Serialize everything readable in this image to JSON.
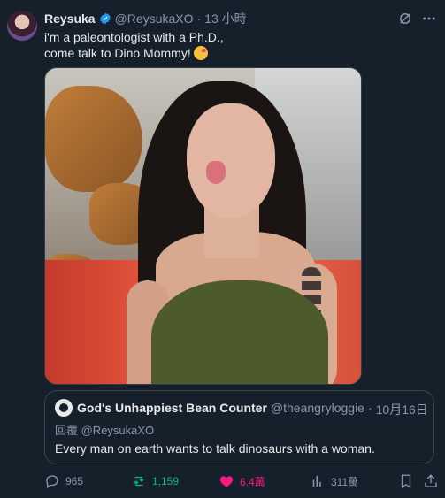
{
  "post": {
    "display_name": "Reysuka",
    "handle": "@ReysukaXO",
    "separator": "·",
    "time": "13 小時",
    "text_line1": "i'm a paleontologist with a Ph.D.,",
    "text_line2": "come talk to Dino Mommy!",
    "emoji": "kissing-face-emoji",
    "verified": true
  },
  "quote": {
    "display_name": "God's Unhappiest Bean Counter",
    "handle": "@theangryloggie",
    "separator": "·",
    "date": "10月16日",
    "reply_to": "回覆 @ReysukaXO",
    "text": "Every man on earth wants to talk dinosaurs with a woman."
  },
  "actions": {
    "replies": "965",
    "retweets": "1,159",
    "likes": "6.4萬",
    "views": "311萬"
  },
  "colors": {
    "background": "#15202b",
    "text": "#e7e9ea",
    "muted": "#8b98a5",
    "verified": "#1d9bf0",
    "retweet": "#00ba7c",
    "like": "#f91880"
  }
}
